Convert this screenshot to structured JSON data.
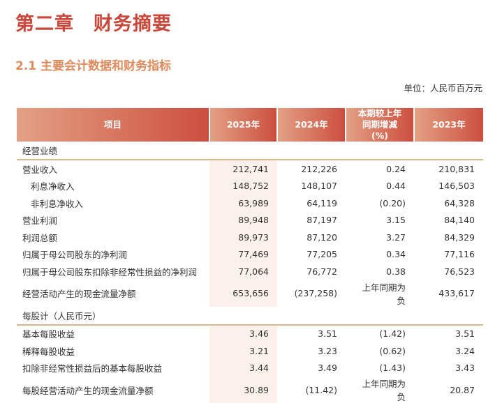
{
  "title": "第二章　财务摘要",
  "subtitle": "2.1 主要会计数据和财务指标",
  "unit": "单位：人民币百万元",
  "headers": [
    "项目",
    "2025年",
    "2024年",
    "本期较上年同期增减(%)",
    "2023年"
  ],
  "sections": [
    {
      "name": "经营业绩",
      "rows": [
        {
          "label": "营业收入",
          "indent": false,
          "v": [
            "212,741",
            "212,226",
            "0.24",
            "210,831"
          ]
        },
        {
          "label": "利息净收入",
          "indent": true,
          "v": [
            "148,752",
            "148,107",
            "0.44",
            "146,503"
          ]
        },
        {
          "label": "非利息净收入",
          "indent": true,
          "v": [
            "63,989",
            "64,119",
            "(0.20)",
            "64,328"
          ]
        },
        {
          "label": "营业利润",
          "indent": false,
          "v": [
            "89,948",
            "87,197",
            "3.15",
            "84,140"
          ]
        },
        {
          "label": "利润总额",
          "indent": false,
          "v": [
            "89,973",
            "87,120",
            "3.27",
            "84,329"
          ]
        },
        {
          "label": "归属于母公司股东的净利润",
          "indent": false,
          "v": [
            "77,469",
            "77,205",
            "0.34",
            "77,116"
          ]
        },
        {
          "label": "归属于母公司股东扣除非经常性损益的净利润",
          "indent": false,
          "v": [
            "77,064",
            "76,772",
            "0.38",
            "76,523"
          ]
        },
        {
          "label": "经营活动产生的现金流量净额",
          "indent": false,
          "v": [
            "653,656",
            "(237,258)",
            "上年同期为负",
            "433,617"
          ]
        }
      ]
    },
    {
      "name": "每股计（人民币元）",
      "rows": [
        {
          "label": "基本每股收益",
          "indent": false,
          "v": [
            "3.46",
            "3.51",
            "(1.42)",
            "3.51"
          ]
        },
        {
          "label": "稀释每股收益",
          "indent": false,
          "v": [
            "3.21",
            "3.23",
            "(0.62)",
            "3.24"
          ]
        },
        {
          "label": "扣除非经常性损益后的基本每股收益",
          "indent": false,
          "v": [
            "3.44",
            "3.49",
            "(1.43)",
            "3.43"
          ]
        },
        {
          "label": "每股经营活动产生的现金流量净额",
          "indent": false,
          "v": [
            "30.89",
            "(11.42)",
            "上年同期为负",
            "20.87"
          ]
        }
      ]
    }
  ]
}
